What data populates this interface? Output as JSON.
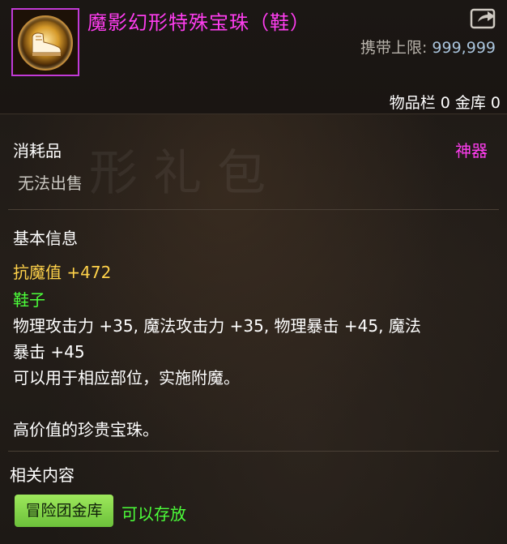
{
  "item": {
    "name": "魔影幻形特殊宝珠（鞋）",
    "carry_limit_label": "携带上限: ",
    "carry_limit_value": "999,999",
    "inventory_text": "物品栏 0 金库 0"
  },
  "info": {
    "type": "消耗品",
    "grade": "神器",
    "sell_status": "无法出售",
    "basic_title": "基本信息",
    "magic_resist": "抗魔值 +472",
    "slot": "鞋子",
    "bonus_line1": "物理攻击力 +35, 魔法攻击力 +35, 物理暴击 +45, 魔法",
    "bonus_line2": "暴击 +45",
    "usage": "可以用于相应部位，实施附魔。",
    "flavor": "高价值的珍贵宝珠。"
  },
  "related": {
    "title": "相关内容",
    "bank_button": "冒险团金库",
    "storable": "可以存放"
  },
  "colors": {
    "item_name": "#ff3df0",
    "grade": "#ff3df0",
    "magic_resist": "#ffd24a",
    "slot": "#4cff3a",
    "storable": "#4cff3a",
    "carry_value": "#a9c4dc"
  },
  "icons": {
    "item": "shoe-orb-icon",
    "share": "share-icon"
  }
}
